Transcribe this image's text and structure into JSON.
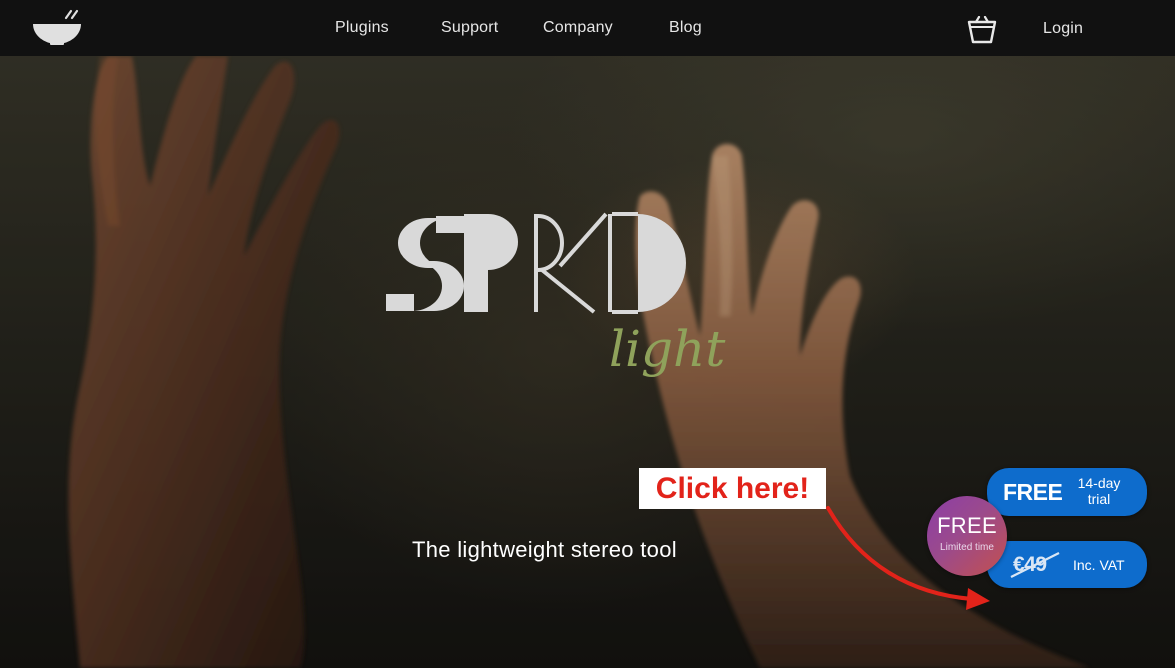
{
  "nav": {
    "links": [
      "Plugins",
      "Support",
      "Company",
      "Blog"
    ],
    "login_label": "Login"
  },
  "icons": {
    "logo": "bowl-logo-icon",
    "cart": "cart-icon"
  },
  "hero": {
    "product_name": "SPRD",
    "product_variant": "light",
    "tagline": "The lightweight stereo tool",
    "callout": "Click here!"
  },
  "trial_button": {
    "label_big": "FREE",
    "label_small": "14-day trial"
  },
  "buy_button": {
    "old_price": "€49",
    "label_small": "Inc. VAT"
  },
  "badge": {
    "title": "FREE",
    "subtitle": "Limited time"
  },
  "colors": {
    "header_bg": "#111111",
    "button_blue": "#0e6ccc",
    "callout_red": "#e2231a",
    "logo_green": "#8fa25b",
    "badge_gradient": [
      "#8c3ea6",
      "#c4504d"
    ]
  }
}
